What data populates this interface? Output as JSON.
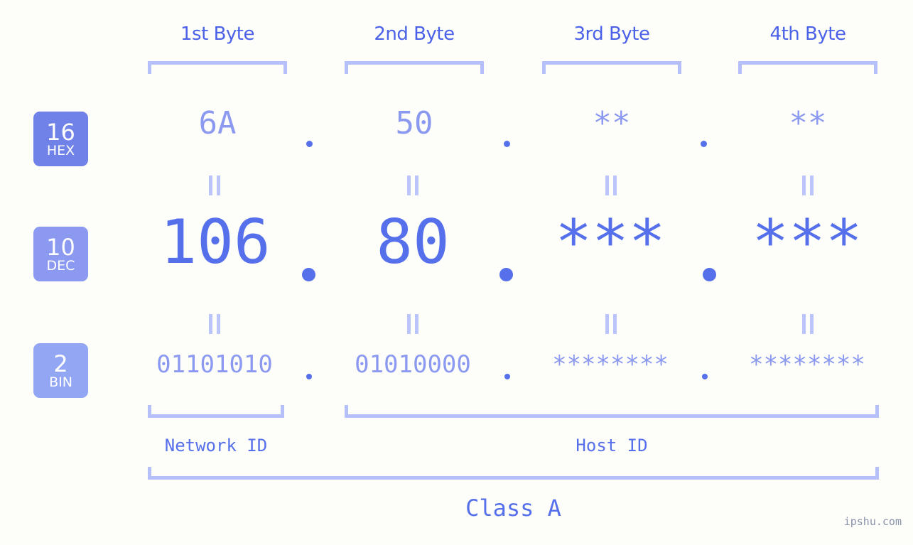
{
  "background_color": "#fdfdfa",
  "accent_colors": {
    "header_text": "#4b62e8",
    "bracket": "#b5bffa",
    "value_strong": "#5570ea",
    "value_light": "#8b99f0",
    "equals_mark": "#bcc5fb",
    "badge_hex": "#7082e8",
    "badge_dec": "#8b99f0",
    "badge_bin": "#92a6f3",
    "watermark": "#8892a8"
  },
  "byte_headers": [
    {
      "label": "1st Byte"
    },
    {
      "label": "2nd Byte"
    },
    {
      "label": "3rd Byte"
    },
    {
      "label": "4th Byte"
    }
  ],
  "bases": [
    {
      "number": "16",
      "name": "HEX"
    },
    {
      "number": "10",
      "name": "DEC"
    },
    {
      "number": "2",
      "name": "BIN"
    }
  ],
  "rows": {
    "hex": {
      "base_number": "16",
      "base_name": "HEX",
      "values": [
        "6A",
        "50",
        "**",
        "**"
      ],
      "separator": "."
    },
    "dec": {
      "base_number": "10",
      "base_name": "DEC",
      "values": [
        "106",
        "80",
        "***",
        "***"
      ],
      "separator": "."
    },
    "bin": {
      "base_number": "2",
      "base_name": "BIN",
      "values": [
        "01101010",
        "01010000",
        "********",
        "********"
      ],
      "separator": "."
    }
  },
  "equals_marks": {
    "symbol": "||",
    "count_per_row": 4
  },
  "id_sections": [
    {
      "label": "Network ID"
    },
    {
      "label": "Host ID"
    }
  ],
  "class_section": {
    "label": "Class A"
  },
  "watermark": {
    "text": "ipshu.com"
  }
}
